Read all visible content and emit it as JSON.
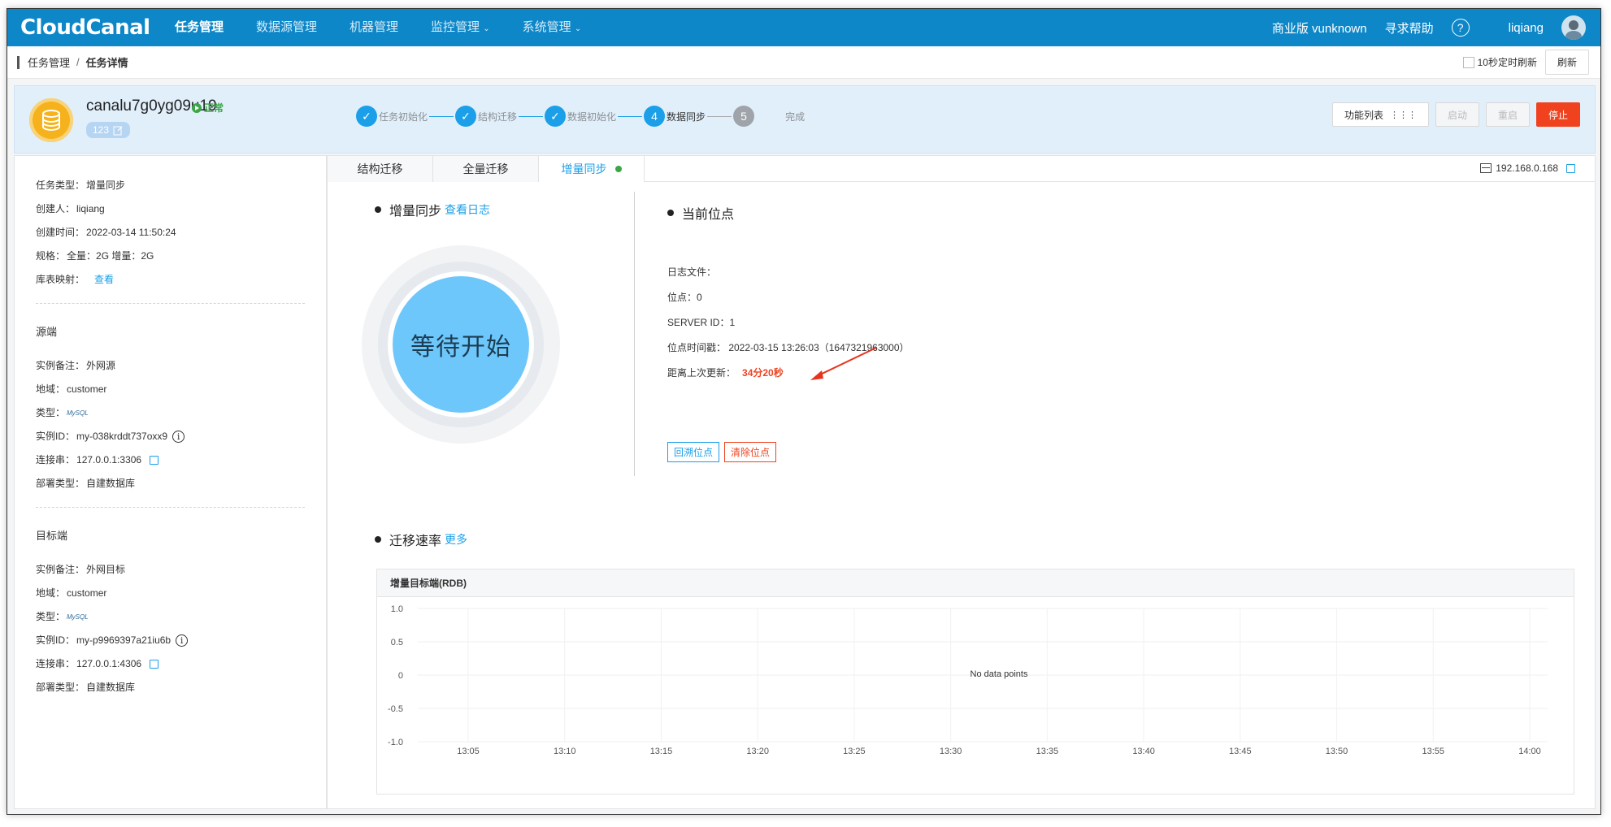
{
  "nav": {
    "logo": "CloudCanal",
    "items": [
      {
        "label": "任务管理",
        "active": true
      },
      {
        "label": "数据源管理"
      },
      {
        "label": "机器管理"
      },
      {
        "label": "监控管理"
      },
      {
        "label": "系统管理"
      }
    ],
    "edition": "商业版 vunknown",
    "help": "寻求帮助",
    "help_icon": "?",
    "user": "liqiang"
  },
  "breadcrumb": {
    "root": "任务管理",
    "sep": "/",
    "current": "任务详情"
  },
  "toolbar": {
    "auto_refresh": "10秒定时刷新",
    "refresh": "刷新"
  },
  "task": {
    "name": "canalu7g0yg09u19",
    "status": "正常",
    "tag": "123",
    "steps": [
      {
        "num": "✓",
        "label": "任务初始化",
        "state": "done"
      },
      {
        "num": "✓",
        "label": "结构迁移",
        "state": "done"
      },
      {
        "num": "✓",
        "label": "数据初始化",
        "state": "done"
      },
      {
        "num": "4",
        "label": "数据同步",
        "state": "active"
      },
      {
        "num": "5",
        "label": "完成",
        "state": "pending"
      }
    ],
    "actions": {
      "func_list": "功能列表",
      "start": "启动",
      "restart": "重启",
      "stop": "停止"
    }
  },
  "left": {
    "basic": [
      {
        "k": "任务类型：",
        "v": "增量同步"
      },
      {
        "k": "创建人：",
        "v": "liqiang"
      },
      {
        "k": "创建时间：",
        "v": "2022-03-14 11:50:24"
      },
      {
        "k": "规格：",
        "v": "全量：2G 增量：2G"
      },
      {
        "k": "库表映射：",
        "v": "查看"
      }
    ],
    "source": {
      "title": "源端",
      "remark": {
        "k": "实例备注：",
        "v": "外网源"
      },
      "region": {
        "k": "地域：",
        "v": "customer"
      },
      "type": {
        "k": "类型：",
        "v": "MySQL"
      },
      "instance": {
        "k": "实例ID：",
        "v": "my-038krddt737oxx9"
      },
      "conn": {
        "k": "连接串：",
        "v": "127.0.0.1:3306"
      },
      "deploy": {
        "k": "部署类型：",
        "v": "自建数据库"
      }
    },
    "target": {
      "title": "目标端",
      "remark": {
        "k": "实例备注：",
        "v": "外网目标"
      },
      "region": {
        "k": "地域：",
        "v": "customer"
      },
      "type": {
        "k": "类型：",
        "v": "MySQL"
      },
      "instance": {
        "k": "实例ID：",
        "v": "my-p9969397a21iu6b"
      },
      "conn": {
        "k": "连接串：",
        "v": "127.0.0.1:4306"
      },
      "deploy": {
        "k": "部署类型：",
        "v": "自建数据库"
      }
    }
  },
  "tabs": [
    {
      "label": "结构迁移"
    },
    {
      "label": "全量迁移"
    },
    {
      "label": "增量同步",
      "active": true
    }
  ],
  "ip": "192.168.0.168",
  "sync": {
    "title": "增量同步",
    "log_link": "查看日志",
    "circle_text": "等待开始"
  },
  "position": {
    "title": "当前位点",
    "log_file": "日志文件：",
    "offset": "位点：0",
    "server_id": "SERVER ID：1",
    "timestamp": "位点时间戳：  2022-03-15 13:26:03（1647321963000）",
    "since_label": "距离上次更新：",
    "since_value": "34分20秒",
    "rollback": "回溯位点",
    "clear": "清除位点"
  },
  "rate": {
    "title": "迁移速率",
    "more": "更多"
  },
  "chart_data": {
    "type": "line",
    "title": "增量目标端(RDB)",
    "x": [
      "13:05",
      "13:10",
      "13:15",
      "13:20",
      "13:25",
      "13:30",
      "13:35",
      "13:40",
      "13:45",
      "13:50",
      "13:55",
      "14:00"
    ],
    "series": [],
    "yticks": [
      "1.0",
      "0.5",
      "0",
      "-0.5",
      "-1.0"
    ],
    "ylim": [
      -1.0,
      1.0
    ],
    "empty_text": "No data points",
    "grid": true
  }
}
